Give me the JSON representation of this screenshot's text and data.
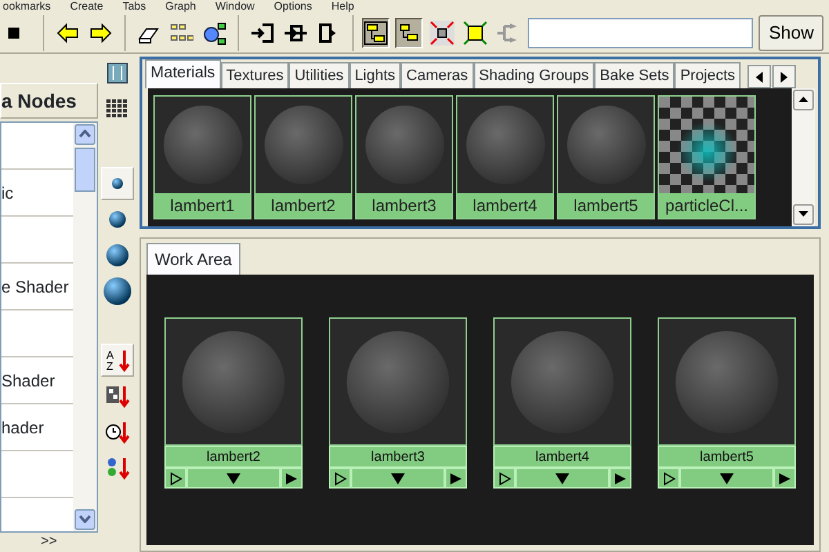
{
  "menu_bar": [
    "ookmarks",
    "Create",
    "Tabs",
    "Graph",
    "Window",
    "Options",
    "Help"
  ],
  "toolbar": {
    "show_button": "Show",
    "toggles": [
      {
        "kind": "graph",
        "on": true
      },
      {
        "kind": "graph-small",
        "on": true
      }
    ]
  },
  "left_panel": {
    "header": "a Nodes",
    "rows": [
      {
        "kind": "blank"
      },
      {
        "kind": "text",
        "label": "ic"
      },
      {
        "kind": "blank"
      },
      {
        "kind": "text",
        "label": "e Shader"
      },
      {
        "kind": "blank"
      },
      {
        "kind": "text",
        "label": "Shader"
      },
      {
        "kind": "text",
        "label": "hader"
      },
      {
        "kind": "blank"
      }
    ],
    "footer": ">>"
  },
  "side_tools": {
    "icon_size": [
      {
        "selected": true
      },
      {
        "selected": false
      },
      {
        "selected": false
      },
      {
        "selected": false
      }
    ],
    "sort": [
      {
        "kind": "alpha",
        "selected": true,
        "top": "A",
        "bottom": "Z"
      },
      {
        "kind": "type",
        "selected": false
      },
      {
        "kind": "time",
        "selected": false
      },
      {
        "kind": "order",
        "selected": false
      }
    ]
  },
  "tabs": [
    {
      "label": "Materials",
      "selected": true
    },
    {
      "label": "Textures",
      "selected": false
    },
    {
      "label": "Utilities",
      "selected": false
    },
    {
      "label": "Lights",
      "selected": false
    },
    {
      "label": "Cameras",
      "selected": false
    },
    {
      "label": "Shading Groups",
      "selected": false
    },
    {
      "label": "Bake Sets",
      "selected": false
    },
    {
      "label": "Projects",
      "selected": false
    }
  ],
  "swatches": [
    {
      "label": "lambert1",
      "kind": "sphere"
    },
    {
      "label": "lambert2",
      "kind": "sphere"
    },
    {
      "label": "lambert3",
      "kind": "sphere"
    },
    {
      "label": "lambert4",
      "kind": "sphere"
    },
    {
      "label": "lambert5",
      "kind": "sphere"
    },
    {
      "label": "particleCl...",
      "kind": "checker"
    }
  ],
  "work_area": {
    "tab": "Work Area",
    "nodes": [
      {
        "label": "lambert2"
      },
      {
        "label": "lambert3"
      },
      {
        "label": "lambert4"
      },
      {
        "label": "lambert5"
      }
    ]
  }
}
